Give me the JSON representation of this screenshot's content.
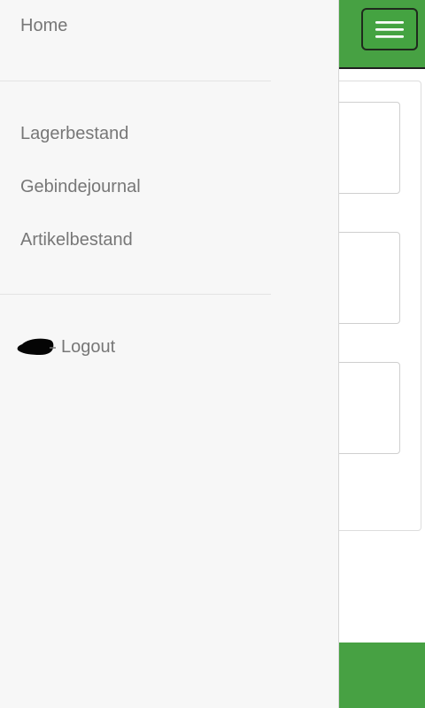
{
  "drawer": {
    "items": [
      {
        "label": "Home"
      },
      {
        "label": "Lagerbestand"
      },
      {
        "label": "Gebindejournal"
      },
      {
        "label": "Artikelbestand"
      }
    ],
    "logout": {
      "label": "Logout",
      "icon": "sign-out-icon"
    }
  },
  "header": {
    "menu_icon": "hamburger-menu-icon"
  },
  "colors": {
    "accent": "#47a143",
    "drawer_background": "#f7f7f7",
    "drawer_text": "#777777"
  }
}
